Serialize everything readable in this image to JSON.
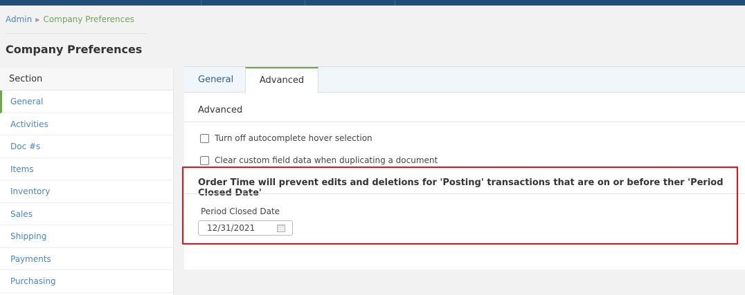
{
  "breadcrumb": {
    "root": "Admin",
    "current": "Company Preferences"
  },
  "page": {
    "title": "Company Preferences"
  },
  "sidebar": {
    "header": "Section",
    "items": [
      {
        "label": "General"
      },
      {
        "label": "Activities"
      },
      {
        "label": "Doc #s"
      },
      {
        "label": "Items"
      },
      {
        "label": "Inventory"
      },
      {
        "label": "Sales"
      },
      {
        "label": "Shipping"
      },
      {
        "label": "Payments"
      },
      {
        "label": "Purchasing"
      }
    ]
  },
  "tabs": {
    "general": "General",
    "advanced": "Advanced"
  },
  "advanced": {
    "heading": "Advanced",
    "options": [
      {
        "label": "Turn off autocomplete hover selection",
        "checked": false
      },
      {
        "label": "Clear custom field data when duplicating a document",
        "checked": false
      }
    ],
    "notice": "Order Time will prevent edits and deletions for 'Posting' transactions that are on or before ther 'Period Closed Date'",
    "period_closed": {
      "label": "Period Closed Date",
      "value": "12/31/2021"
    }
  },
  "colors": {
    "accent": "#6aa84f",
    "link": "#4a86c5",
    "topbar": "#1f4e79",
    "highlight": "#e3101a"
  }
}
